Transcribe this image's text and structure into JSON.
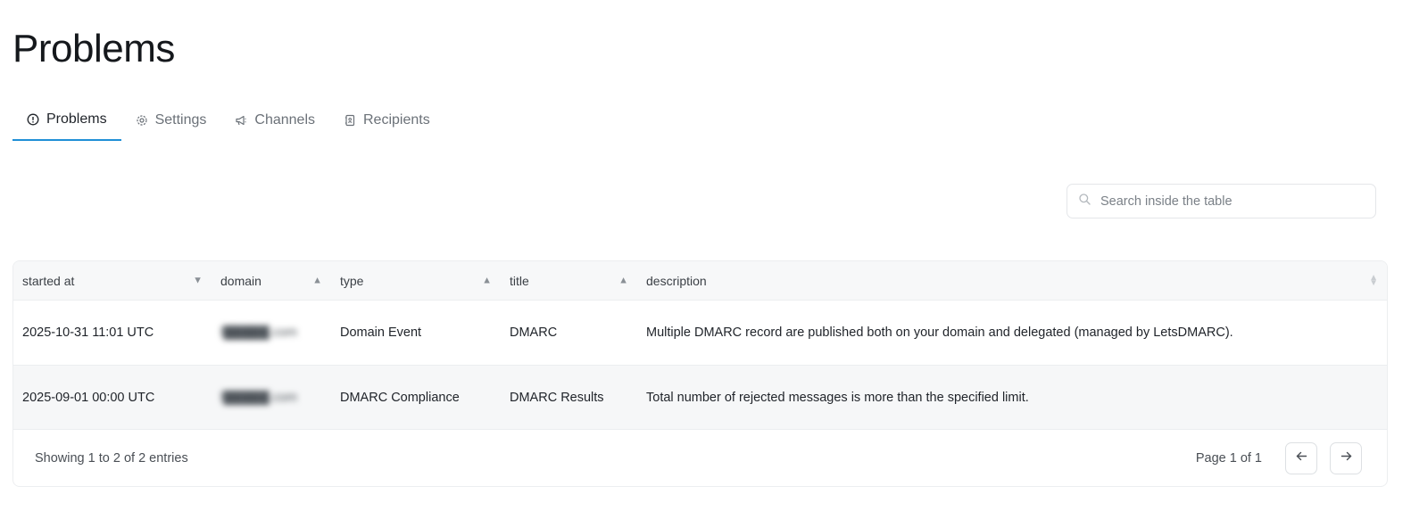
{
  "page": {
    "title": "Problems"
  },
  "tabs": [
    {
      "label": "Problems",
      "icon": "alert-circle-icon",
      "active": true
    },
    {
      "label": "Settings",
      "icon": "gear-icon",
      "active": false
    },
    {
      "label": "Channels",
      "icon": "megaphone-icon",
      "active": false
    },
    {
      "label": "Recipients",
      "icon": "contact-book-icon",
      "active": false
    }
  ],
  "search": {
    "placeholder": "Search inside the table",
    "value": ""
  },
  "table": {
    "columns": [
      {
        "label": "started at",
        "sort": "desc"
      },
      {
        "label": "domain",
        "sort": "asc"
      },
      {
        "label": "type",
        "sort": "asc"
      },
      {
        "label": "title",
        "sort": "asc"
      },
      {
        "label": "description",
        "sort": "none"
      }
    ],
    "rows": [
      {
        "started_at": "2025-10-31 11:01 UTC",
        "domain": "l█████.com",
        "type": "Domain Event",
        "title": "DMARC",
        "description": "Multiple DMARC record are published both on your domain and delegated (managed by LetsDMARC)."
      },
      {
        "started_at": "2025-09-01 00:00 UTC",
        "domain": "l█████.com",
        "type": "DMARC Compliance",
        "title": "DMARC Results",
        "description": "Total number of rejected messages is more than the specified limit."
      }
    ]
  },
  "footer": {
    "entries": "Showing 1 to 2 of 2 entries",
    "page_info": "Page 1 of 1"
  },
  "colors": {
    "accent": "#1f8fd6",
    "header_bg": "#f7f8f9",
    "alt_row_bg": "#f6f7f8"
  }
}
